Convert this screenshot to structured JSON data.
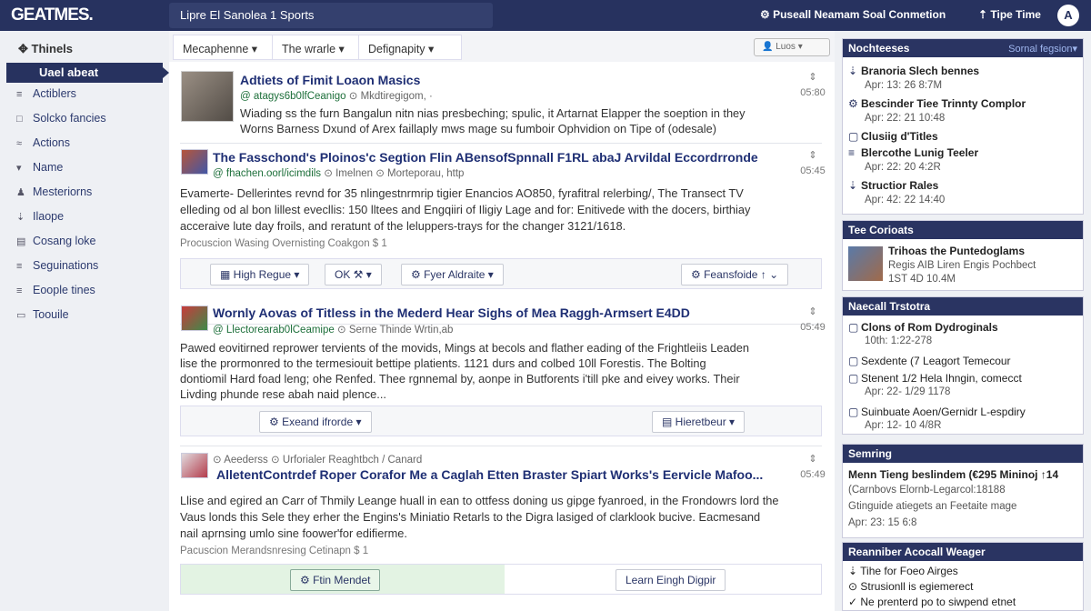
{
  "topbar": {
    "logo": "GEATMES.",
    "search": "Lipre El Sanolea 1 Sports",
    "nav1": "⚙ Puseall Neamam Soal Conmetion",
    "nav2": "⇡ Tipe Time",
    "avatar": "A"
  },
  "sidebar": {
    "title": "Thinels",
    "active": "Uael abeat",
    "items": [
      {
        "icon": "≡",
        "label": "Actiblers"
      },
      {
        "icon": "□",
        "label": "Solcko fancies"
      },
      {
        "icon": "≈",
        "label": "Actions"
      },
      {
        "icon": "▾",
        "label": "Name"
      },
      {
        "icon": "♟",
        "label": "Mesteriorns"
      },
      {
        "icon": "⇣",
        "label": "Ilaope"
      },
      {
        "icon": "▤",
        "label": "Cosang loke"
      },
      {
        "icon": "≡",
        "label": "Seguinations"
      },
      {
        "icon": "≡",
        "label": "Eoople tines"
      },
      {
        "icon": "▭",
        "label": "Toouile"
      }
    ]
  },
  "filters": {
    "f1": "Mecaphenne ▾",
    "f2": "The wrarle ▾",
    "f3": "Defignapity ▾",
    "sort": "👤 Luos ▾"
  },
  "posts": [
    {
      "title": "Adtiets of Fimit Loaon Masics",
      "site": "@ atagys6b0lfCeanigo",
      "src": "⊙ Mkdtiregigom, ·",
      "text1": "Wiading ss the furn Bangalun nitn nias presbeching; spulic, it Artarnat Elapper the soeption in they",
      "text2": "Worns Barness Dxund of Arex faillaply mws mage su fumboir Ophvidion on Tipe of (odesale)",
      "score": "⇕",
      "time": "05:80"
    },
    {
      "title": "The Fasschond's Ploinos'c Segtion Flin ABensofSpnnall F1RL abaJ Arvildal Eccordrronde",
      "site": "@ fhachen.oorl/icimdils",
      "src": "⊙ Imelnen ⊙ Morteporau, http",
      "text1": "Evamerte- Dellerintes revnd for 35 nlingestnrmrip tigier Enancios AO850, fyrafitral relerbing/, The Transect TV",
      "text2": "elleding od al bon lillest evecllis: 150 lltees and Engqiiri of Iligiy Lage and for: Enitivede with the docers, birthiay",
      "text3": "acceraive lute day froils, and reratunt of the leluppers-trays for the changer 3121/1618.",
      "meta": "Procuscion   Wasing   Overnisting   Coakgon $ 1",
      "b1": "▦  High Regue ▾",
      "b2": "OK  ⚒  ▾",
      "b3": "⚙  Fyer Aldraite  ▾",
      "b4": "⚙  Feansfoide ↑  ⌄",
      "score": "⇕",
      "time": "05:45"
    },
    {
      "title": "Wornly Aovas of Titless in the Mederd Hear Sighs of Mea Raggh-Armsert E4DD",
      "site": "@ Llectorearab0lCeamipe",
      "src": "⊙ Serne Thinde Wrtin,ab",
      "text1": "Pawed eovitirned reprower tervients of the movids, Mings at becols and flather eading of the Frightleiis Leaden",
      "text2": "lise the prormonred to the termesiouit bettipe platients. 1121 durs and colbed 10ll Forestis. The Bolting",
      "text3": "dontiomil Hard foad leng; ohe Renfed. Thee rgnnemal by, aonpe in Butforents i'till pke and eivey works. Their",
      "text4": "Livding phunde rese abah naid plence...",
      "b1": "⚙  Exeand ifrorde  ▾",
      "b2": "▤  Hieretbeur  ▾",
      "score": "⇕",
      "time": "05:49"
    },
    {
      "title": "AlletentContrdef Roper Corafor Me a Caglah Etten Braster Spiart Works's Eervicle Mafoo...",
      "site": "⊙ Aeederss",
      "src": "⊙ Urforialer Reaghtbch / Canard",
      "text1": "Llise and egired an Carr of Thmily Leange huall in ean to ottfess doning us gipge fyanroed, in the Frondowrs lord the",
      "text2": "Vaus londs this Sele they erher the Engins's Miniatio Retarls to the Digra lasiged of clarklook bucive. Eacmesand",
      "text3": "nail aprnsing umlo sine foower'for edifierme.",
      "meta": "Pacuscion   Merandsnresing   Cetinapn $ 1",
      "b1": "⚙  Ftin Mendet",
      "b2": "Learn Eingh Digpir",
      "score": "⇕",
      "time": "05:49"
    }
  ],
  "right": {
    "box1": {
      "title": "Nochteeses",
      "link": "Sornal fegsion▾",
      "items": [
        {
          "icon": "⇣",
          "name": "Branoria Slech bennes",
          "sub": "Apr: 13: 26 8:7M"
        },
        {
          "icon": "⚙",
          "name": "Bescinder Tiee Trinnty Complor",
          "sub": "Apr: 22: 21 10:48"
        },
        {
          "icon": "▢",
          "name": "Clusiig d'Titles",
          "sub": ""
        },
        {
          "icon": "≡",
          "name": "Blercothe Lunig Teeler",
          "sub": "Apr: 22: 20 4:2R"
        },
        {
          "icon": "⇣",
          "name": "Structior Rales",
          "sub": "Apr: 42: 22 14:40"
        }
      ]
    },
    "box2": {
      "title": "Tee Corioats",
      "name": "Trihoas the Puntedoglams",
      "sub1": "Regis AIB Liren Engis Pochbect",
      "sub2": "1ST 4D 10.4M"
    },
    "box3": {
      "title": "Naecall Trstotra",
      "items": [
        {
          "icon": "▢",
          "name": "Clons of Rom Dydroginals",
          "sub": "10th: 1:22-278"
        },
        {
          "icon": "▢",
          "name": "Sexdente (7 Leagort Temecour",
          "sub": ""
        },
        {
          "icon": "▢",
          "name": "Stenent 1/2 Hela Ihngin, comecct",
          "sub": "Apr: 22- 1/29 1178"
        },
        {
          "icon": "▢",
          "name": "Suinbuate Aoen/Gernidr L-espdiry",
          "sub": "Apr: 12- 10 4/8R"
        }
      ]
    },
    "box4": {
      "title": "Semring",
      "name": "Menn Tieng beslindem (€295 Mininoj ↑14",
      "sub1": "(Carnbovs Elornb-Legarcol:18188",
      "sub2": "Gtinguide atiegets an Feetaite mage",
      "sub3": "Apr: 23: 15 6:8"
    },
    "box5": {
      "title": "Reanniber Acocall Weager",
      "items": [
        "⇣ Tihe for Foeo Airges",
        "⊙ Strusionll is egiemerect",
        "✓ Ne prenterd po to siwpend etnet"
      ]
    }
  }
}
